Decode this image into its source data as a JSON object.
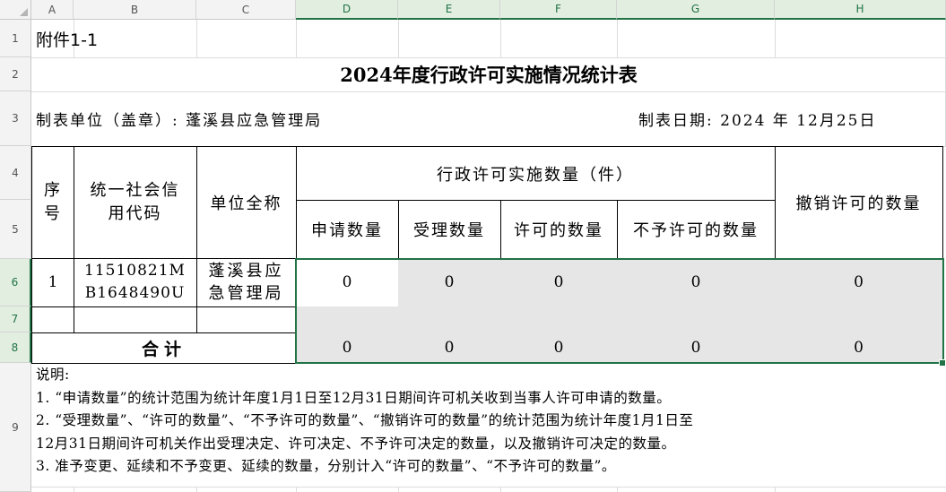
{
  "columns": [
    "A",
    "B",
    "C",
    "D",
    "E",
    "F",
    "G",
    "H"
  ],
  "rows": [
    "1",
    "2",
    "3",
    "4",
    "5",
    "6",
    "7",
    "8",
    "9"
  ],
  "sheet": {
    "attachment_label": "附件1-1",
    "title": "2024年度行政许可实施情况统计表",
    "unit_label": "制表单位（盖章）: 蓬溪县应急管理局",
    "date_label": "制表日期: 2024 年 12月25日",
    "headers": {
      "seq": "序号",
      "credit_code": "统一社会信用代码",
      "unit_name": "单位全称",
      "group": "行政许可实施数量（件）",
      "apply": "申请数量",
      "accept": "受理数量",
      "permit": "许可的数量",
      "deny": "不予许可的数量",
      "revoke": "撤销许可的数量"
    },
    "data_row": {
      "seq": "1",
      "credit_code": "11510821MB1648490U",
      "unit_name": "蓬溪县应急管理局",
      "apply": "0",
      "accept": "0",
      "permit": "0",
      "deny": "0",
      "revoke": "0"
    },
    "total_row": {
      "label": "合计",
      "apply": "0",
      "accept": "0",
      "permit": "0",
      "deny": "0",
      "revoke": "0"
    },
    "notes": {
      "heading": "说明:",
      "line1": "1.  “申请数量”的统计范围为统计年度1月1日至12月31日期间许可机关收到当事人许可申请的数量。",
      "line2": "2.  “受理数量”、“许可的数量”、“不予许可的数量”、“撤销许可的数量”的统计范围为统计年度1月1日至",
      "line3": "12月31日期间许可机关作出受理决定、许可决定、不予许可决定的数量，以及撤销许可决定的数量。",
      "line4": "3.  准予变更、延续和不予变更、延续的数量，分别计入“许可的数量”、“不予许可的数量”。"
    }
  },
  "colors": {
    "selection": "#217346",
    "fill": "#e6e6e6"
  }
}
